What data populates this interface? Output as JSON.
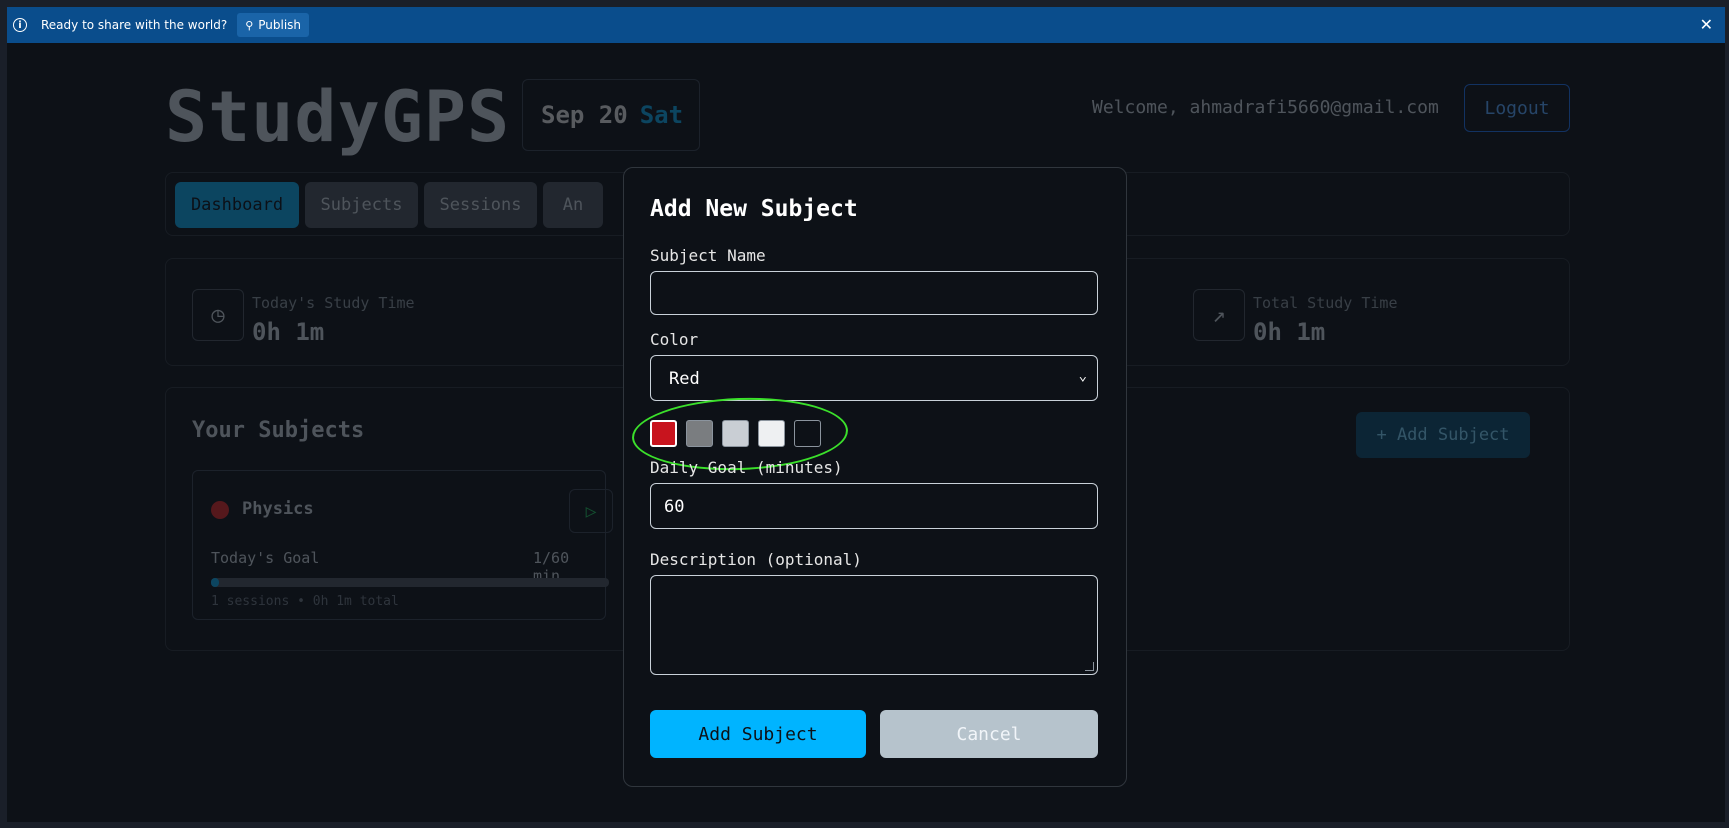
{
  "banner": {
    "message": "Ready to share with the world?",
    "publish_label": "Publish",
    "info_icon": "i",
    "close_icon": "✕"
  },
  "header": {
    "logo": "StudyGPS",
    "date": "Sep 20",
    "weekday": "Sat",
    "welcome": "Welcome, ahmadrafi5660@gmail.com",
    "logout_label": "Logout"
  },
  "tabs": [
    {
      "label": "Dashboard",
      "active": true
    },
    {
      "label": "Subjects"
    },
    {
      "label": "Sessions"
    },
    {
      "label": "An"
    }
  ],
  "stats": {
    "today_label": "Today's Study Time",
    "today_value": "0h 1m",
    "total_label": "Total Study Time",
    "total_value": "0h 1m"
  },
  "subjects": {
    "title": "Your Subjects",
    "add_label": "+ Add Subject",
    "items": [
      {
        "name": "Physics",
        "color": "#dc2626",
        "goal_label": "Today's Goal",
        "goal_value": "1/60 min",
        "progress": 0.017,
        "meta": "1 sessions • 0h 1m total"
      }
    ]
  },
  "modal": {
    "title": "Add New Subject",
    "name_label": "Subject Name",
    "name_value": "",
    "color_label": "Color",
    "color_value": "Red",
    "swatches": [
      "#c8141e",
      "#7a7d80",
      "#c9ced4",
      "#eef0f2",
      "#0d1117"
    ],
    "goal_label": "Daily Goal (minutes)",
    "goal_value": "60",
    "description_label": "Description (optional)",
    "description_value": "",
    "submit_label": "Add Subject",
    "cancel_label": "Cancel"
  }
}
